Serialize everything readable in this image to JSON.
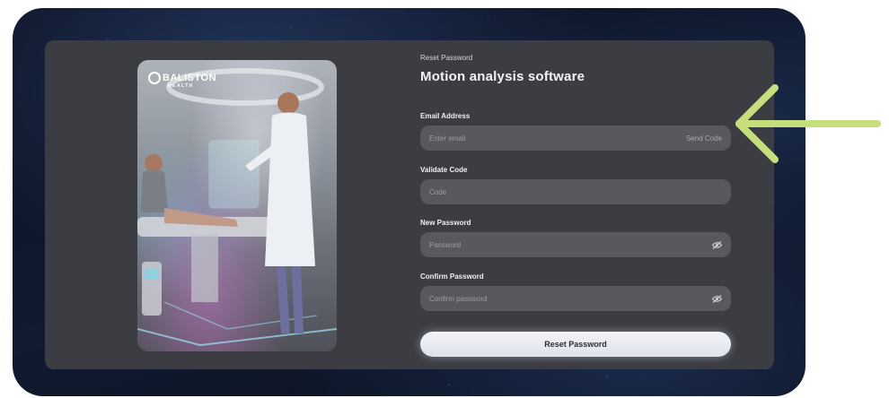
{
  "brand": {
    "name": "BALISTON",
    "subtitle": "HEALTH"
  },
  "form": {
    "eyebrow": "Reset Password",
    "title": "Motion analysis software",
    "email": {
      "label": "Email Address",
      "placeholder": "Enter email",
      "action": "Send Code"
    },
    "code": {
      "label": "Validate Code",
      "placeholder": "Code"
    },
    "new_password": {
      "label": "New Password",
      "placeholder": "Password",
      "icon": "eye-off-icon"
    },
    "confirm_password": {
      "label": "Confirm Password",
      "placeholder": "Confirm password",
      "icon": "eye-off-icon"
    },
    "submit_label": "Reset Password"
  },
  "annotation": {
    "icon": "arrow-left-icon",
    "color": "#c5e07a"
  },
  "colors": {
    "panel": "#3b3d42",
    "field": "#57595f",
    "button": "#eef0f5"
  }
}
